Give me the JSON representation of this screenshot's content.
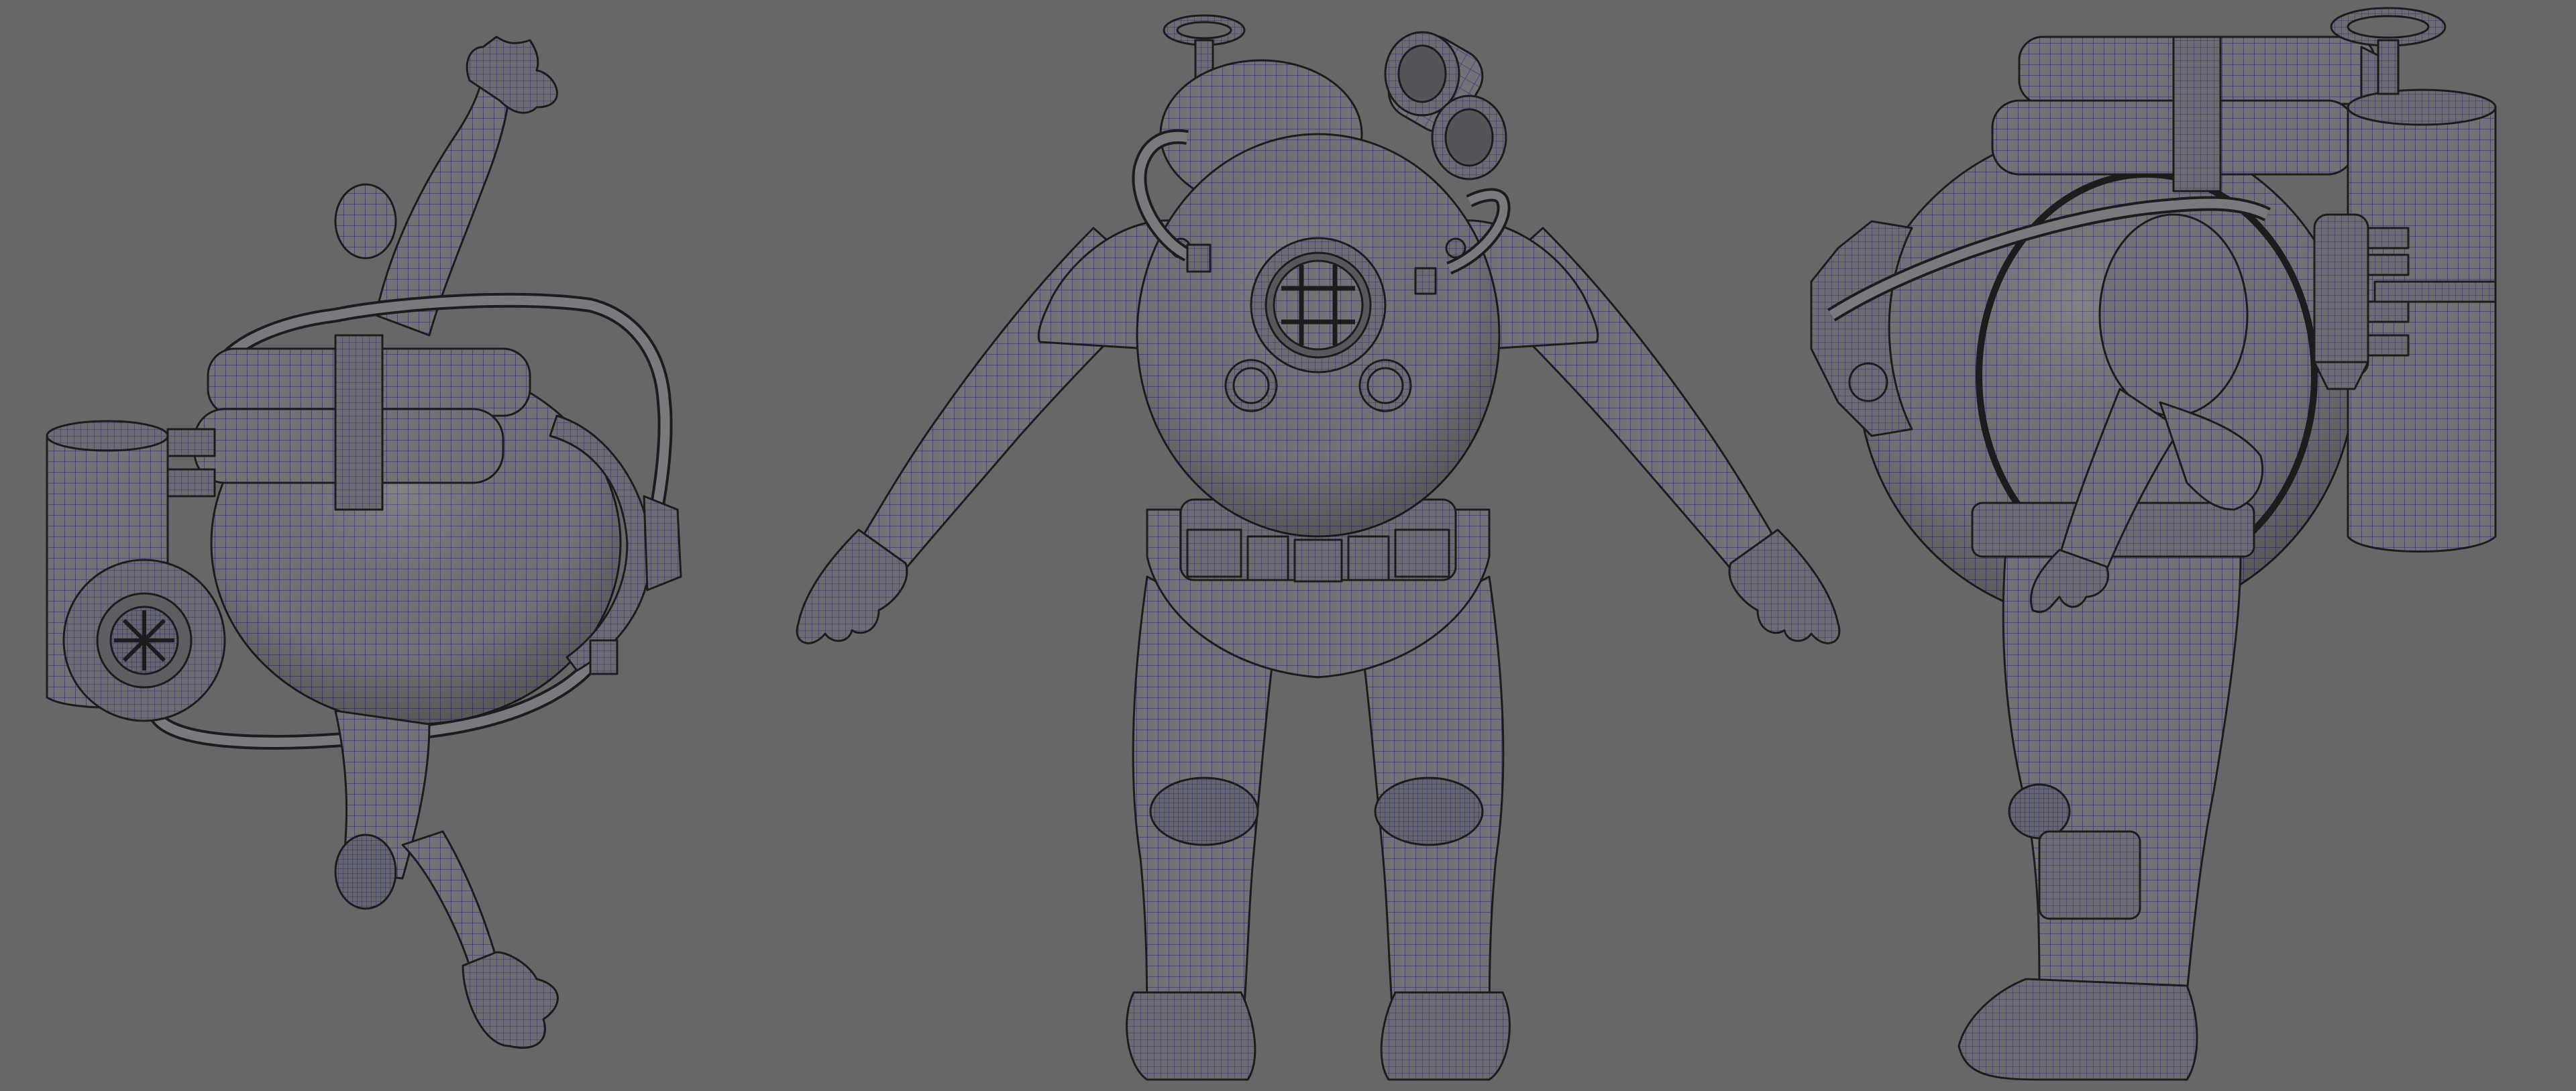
{
  "viewport": {
    "background": "#676767",
    "mesh_fill": "#6e6e72",
    "mesh_fill_light": "#7c7c80",
    "wire_color": "#2a2a8c",
    "outline_color": "#1c1c1c"
  },
  "views": [
    {
      "id": "top",
      "content": "diver-suit-top-view"
    },
    {
      "id": "front",
      "content": "diver-suit-front-view"
    },
    {
      "id": "side",
      "content": "diver-suit-side-view"
    }
  ]
}
